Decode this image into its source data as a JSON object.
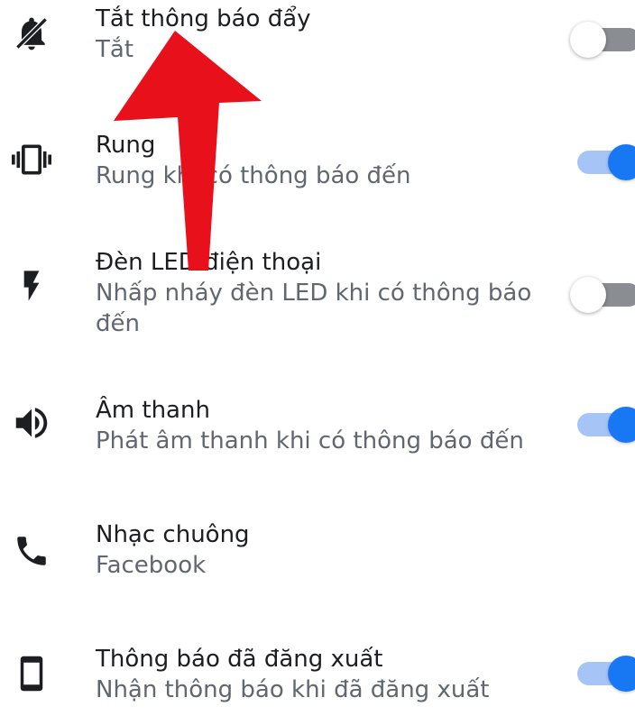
{
  "colors": {
    "title_text": "#1c1e21",
    "subtitle_text": "#606770",
    "toggle_on_knob": "#1877f2",
    "toggle_on_track": "#a7c4f7",
    "toggle_off_knob": "#ffffff",
    "toggle_off_track": "#8a8d91",
    "annotation_arrow": "#e8101b"
  },
  "settings": [
    {
      "icon": "notifications-off-icon",
      "title": "Tắt thông báo đẩy",
      "subtitle": "Tắt",
      "toggle": "off"
    },
    {
      "icon": "vibrate-icon",
      "title": "Rung",
      "subtitle": "Rung khi có thông báo đến",
      "toggle": "on"
    },
    {
      "icon": "flash-icon",
      "title": "Đèn LED điện thoại",
      "subtitle": "Nhấp nháy đèn LED khi có thông báo đến",
      "toggle": "off"
    },
    {
      "icon": "volume-icon",
      "title": "Âm thanh",
      "subtitle": "Phát âm thanh khi có thông báo đến",
      "toggle": "on"
    },
    {
      "icon": "phone-icon",
      "title": "Nhạc chuông",
      "subtitle": "Facebook",
      "toggle": "none"
    },
    {
      "icon": "smartphone-icon",
      "title": "Thông báo đã đăng xuất",
      "subtitle": "Nhận thông báo khi đã đăng xuất",
      "toggle": "on"
    }
  ]
}
